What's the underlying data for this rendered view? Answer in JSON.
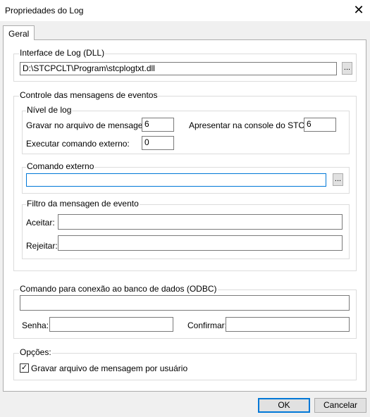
{
  "window": {
    "title": "Propriedades do Log",
    "close_glyph": "✕"
  },
  "tabs": [
    {
      "label": "Geral"
    }
  ],
  "log_interface": {
    "legend": "Interface de Log (DLL)",
    "path_value": "D:\\STCPCLT\\Program\\stcplogtxt.dll",
    "browse_label": "..."
  },
  "event_control": {
    "legend": "Controle das mensagens de eventos",
    "log_level": {
      "legend": "Nível de log",
      "file_label": "Gravar no arquivo de mensagem:",
      "file_value": "6",
      "console_label": "Apresentar na console do STCP:",
      "console_value": "6",
      "exec_label": "Executar comando externo:",
      "exec_value": "0"
    },
    "external_command": {
      "legend": "Comando externo",
      "value": "",
      "browse_label": "..."
    },
    "filter": {
      "legend": "Filtro da mensagen de evento",
      "accept_label": "Aceitar:",
      "accept_value": "",
      "reject_label": "Rejeitar:",
      "reject_value": ""
    }
  },
  "odbc": {
    "legend": "Comando para conexão ao banco de dados (ODBC)",
    "value": "",
    "password_label": "Senha:",
    "password_value": "",
    "confirm_label": "Confirmar:",
    "confirm_value": ""
  },
  "options": {
    "legend": "Opções:",
    "per_user_label": "Gravar arquivo de mensagem por usuário",
    "per_user_checked": true,
    "check_glyph": "✓"
  },
  "buttons": {
    "ok": "OK",
    "cancel": "Cancelar"
  },
  "colors": {
    "focus_accent": "#0078d7",
    "dialog_bg": "#f0f0f0",
    "panel_bg": "#ffffff"
  }
}
